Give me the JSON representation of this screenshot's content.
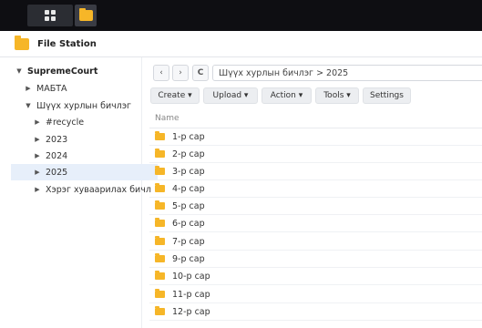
{
  "app": {
    "title": "File Station"
  },
  "sidebar": {
    "root": "SupremeCourt",
    "items": [
      {
        "label": "МАБТА"
      },
      {
        "label": "Шүүх хурлын бичлэг"
      },
      {
        "label": "#recycle"
      },
      {
        "label": "2023"
      },
      {
        "label": "2024"
      },
      {
        "label": "2025"
      },
      {
        "label": "Хэрэг хуваарилах бичл"
      }
    ]
  },
  "toolbar": {
    "back": "‹",
    "forward": "›",
    "refresh": "C",
    "path": "Шүүх хурлын бичлэг > 2025",
    "create": "Create ▾",
    "upload": "Upload ▾",
    "action": "Action ▾",
    "tools": "Tools ▾",
    "settings": "Settings"
  },
  "list": {
    "header": "Name",
    "rows": [
      "1-р сар",
      "2-р сар",
      "3-р сар",
      "4-р сар",
      "5-р сар",
      "6-р сар",
      "7-р сар",
      "9-р сар",
      "10-р сар",
      "11-р сар",
      "12-р сар"
    ]
  },
  "colors": {
    "folder": "#f6b628",
    "selection": "#e7effa",
    "taskbar": "#0e0e12"
  }
}
